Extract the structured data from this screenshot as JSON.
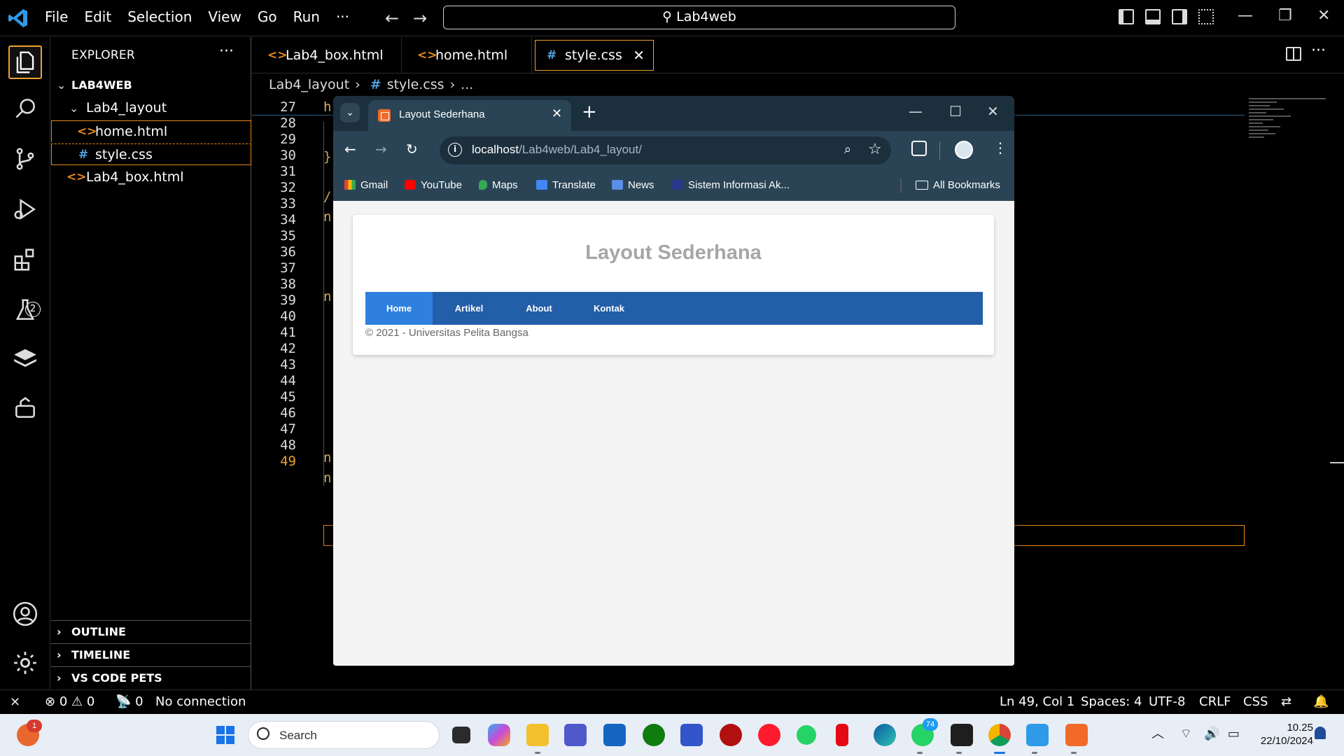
{
  "vscode": {
    "menu": [
      "File",
      "Edit",
      "Selection",
      "View",
      "Go",
      "Run"
    ],
    "menu_more": "···",
    "command_center": "Lab4web",
    "explorer": {
      "title": "EXPLORER",
      "more": "···",
      "workspace": "LAB4WEB",
      "folder": "Lab4_layout",
      "files": [
        {
          "name": "home.html",
          "icon": "<>"
        },
        {
          "name": "style.css",
          "icon": "#"
        }
      ],
      "root_file": {
        "name": "Lab4_box.html",
        "icon": "<>"
      },
      "outline": "OUTLINE",
      "timeline": "TIMELINE",
      "pets": "VS CODE PETS"
    },
    "tabs": [
      {
        "label": "Lab4_box.html",
        "icon": "<>"
      },
      {
        "label": "home.html",
        "icon": "<>"
      },
      {
        "label": "style.css",
        "icon": "#"
      }
    ],
    "tab_close": "✕",
    "breadcrumb": [
      "Lab4_layout",
      "style.css",
      "..."
    ],
    "line_numbers": [
      "27",
      "28",
      "29",
      "30",
      "31",
      "32",
      "33",
      "34",
      "35",
      "36",
      "37",
      "38",
      "39",
      "40",
      "41",
      "42",
      "43",
      "44",
      "45",
      "46",
      "47",
      "48",
      "49"
    ],
    "code_fragments": {
      "l27": "h",
      "l30": "}",
      "l32": "/",
      "l33": "n",
      "l37": "n",
      "l45": "n",
      "l46": "n"
    },
    "extensions_badge": "2",
    "status": {
      "errors": "0",
      "warnings": "0",
      "ports": "0",
      "connection": "No connection",
      "position": "Ln 49, Col 1",
      "spaces": "Spaces: 4",
      "encoding": "UTF-8",
      "eol": "CRLF",
      "language": "CSS"
    }
  },
  "browser": {
    "tab_title": "Layout Sederhana",
    "url_host": "localhost",
    "url_path": "/Lab4web/Lab4_layout/",
    "bookmarks": [
      "Gmail",
      "YouTube",
      "Maps",
      "Translate",
      "News",
      "Sistem Informasi Ak..."
    ],
    "all_bookmarks": "All Bookmarks",
    "page": {
      "title": "Layout Sederhana",
      "nav": [
        "Home",
        "Artikel",
        "About",
        "Kontak"
      ],
      "active_nav": "Home",
      "footer": "© 2021 - Universitas Pelita Bangsa"
    }
  },
  "taskbar": {
    "search_label": "Search",
    "whatsapp_badge": "74",
    "widget_badge": "1",
    "time": "10.25",
    "date": "22/10/2024"
  },
  "colors": {
    "accent_orange": "#e8891a",
    "vscode_blue": "#4fa3e0",
    "browser_chrome": "#2a4455",
    "site_nav": "#235ea8",
    "site_nav_active": "#2f80de"
  }
}
